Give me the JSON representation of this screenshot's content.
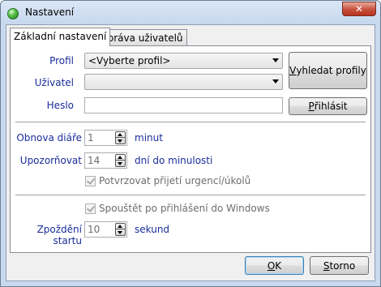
{
  "window": {
    "title": "Nastavení",
    "close_symbol": "✕"
  },
  "tabs": [
    {
      "label": "Základní nastavení",
      "active": true
    },
    {
      "label": "Správa uživatelů",
      "active": false
    }
  ],
  "login": {
    "profile_label": "Profil",
    "profile_value": "<Vyberte profil>",
    "user_label": "Uživatel",
    "user_value": "",
    "password_label": "Heslo",
    "password_value": "",
    "find_profiles_label": "Vyhledat profily",
    "find_profiles_underline": "V",
    "find_profiles_rest": "yhledat profily",
    "login_label": "Přihlásit",
    "login_underline": "P",
    "login_rest": "řihlásit"
  },
  "diary": {
    "refresh_label": "Obnova diáře",
    "refresh_value": "1",
    "refresh_unit": "minut",
    "remind_label": "Upozorňovat",
    "remind_value": "14",
    "remind_unit": "dní do minulosti",
    "confirm_label": "Potvrzovat přijetí urgencí/úkolů",
    "confirm_checked": true
  },
  "startup": {
    "run_label": "Spouštět po přihlášení do Windows",
    "run_checked": true,
    "delay_label": "Zpoždění startu",
    "delay_value": "10",
    "delay_unit": "sekund"
  },
  "footer": {
    "ok_label": "OK",
    "ok_underline": "O",
    "ok_rest": "K",
    "cancel_label": "Storno",
    "cancel_underline": "S",
    "cancel_rest": "torno"
  },
  "colors": {
    "label_blue": "#1a2d9a",
    "disabled_gray": "#6d6d6d"
  }
}
